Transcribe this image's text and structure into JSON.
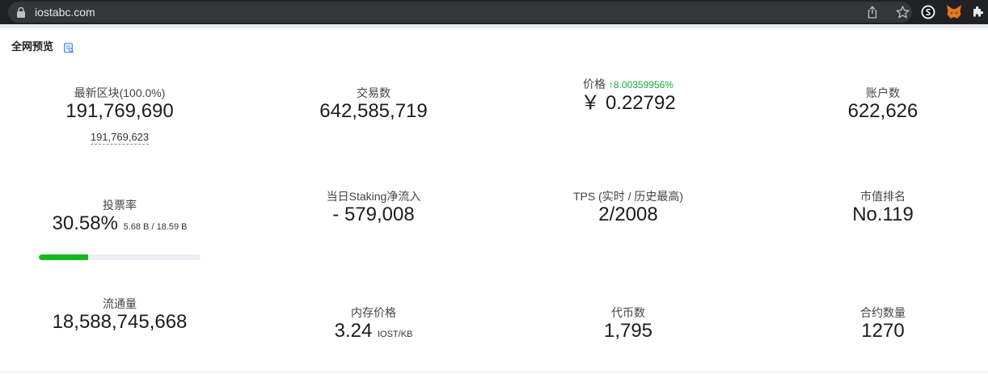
{
  "browser": {
    "url": "iostabc.com"
  },
  "section": {
    "title": "全网预览",
    "title_icon": "search-document-icon"
  },
  "stats": {
    "latest_block": {
      "label": "最新区块(100.0%)",
      "value": "191,769,690",
      "sub": "191,769,623"
    },
    "tx_count": {
      "label": "交易数",
      "value": "642,585,719"
    },
    "price": {
      "label": "价格",
      "change": "↑8.00359956%",
      "value": "￥ 0.22792"
    },
    "accounts": {
      "label": "账户数",
      "value": "622,626"
    },
    "vote_rate": {
      "label": "投票率",
      "value": "30.58%",
      "detail": "5.68 B / 18.59 B",
      "progress": 0.3058
    },
    "staking": {
      "label": "当日Staking净流入",
      "value": "- 579,008"
    },
    "tps": {
      "label": "TPS (实时 / 历史最高)",
      "value": "2/2008"
    },
    "market_rank": {
      "label": "市值排名",
      "value": "No.119"
    },
    "circulation": {
      "label": "流通量",
      "value": "18,588,745,668"
    },
    "ram_price": {
      "label": "内存价格",
      "value": "3.24",
      "unit": "IOST/KB"
    },
    "tokens": {
      "label": "代币数",
      "value": "1,795"
    },
    "contracts": {
      "label": "合约数量",
      "value": "1270"
    }
  },
  "colors": {
    "accent_green": "#15b81c",
    "price_up": "#1aab3a",
    "browser_bg": "#202124"
  }
}
